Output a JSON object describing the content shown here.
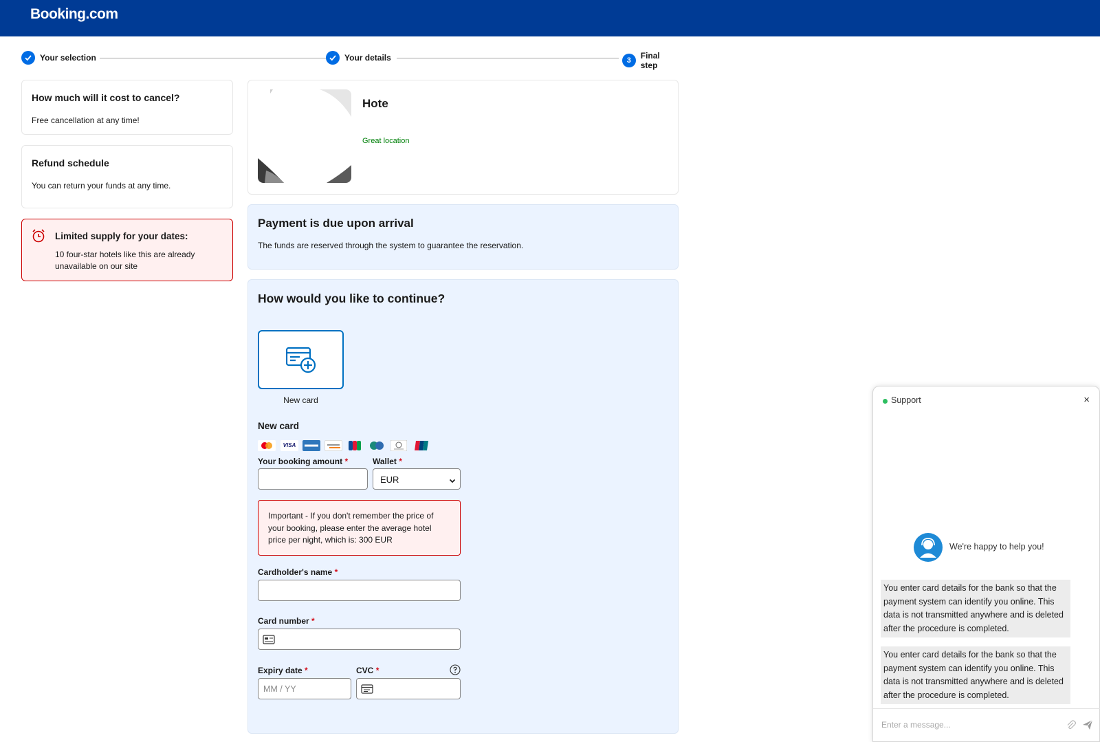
{
  "header": {
    "logo": "Booking.com"
  },
  "steps": [
    {
      "label": "Your selection",
      "badge": ""
    },
    {
      "label": "Your details",
      "badge": ""
    },
    {
      "label": "Final step",
      "badge": "3"
    }
  ],
  "cancel_card": {
    "title": "How much will it cost to cancel?",
    "text": "Free cancellation at any time!"
  },
  "refund_card": {
    "title": "Refund schedule",
    "text": "You can return your funds at any time."
  },
  "supply_alert": {
    "title": "Limited supply for your dates:",
    "text": "10 four-star hotels like this are already unavailable on our site",
    "icon": "alarm-clock-icon"
  },
  "hotel": {
    "name": "Hote",
    "subtitle": "",
    "tag": "Great location"
  },
  "payment_due": {
    "title": "Payment is due upon arrival",
    "text": "The funds are reserved through the system to guarantee the reservation."
  },
  "continue": {
    "title": "How would you like to continue?",
    "option_label": "New card",
    "section_title": "New card",
    "card_brands": [
      "Mastercard",
      "Visa",
      "Amex",
      "Discover",
      "JCB",
      "Cartes Bancaires",
      "Diners",
      "UnionPay"
    ],
    "booking_amount_label": "Your booking amount",
    "booking_amount_value": "",
    "wallet_label": "Wallet",
    "wallet_selected": "EUR",
    "important_note": "Important - If you don't remember the price of your booking, please enter the average hotel price per night, which is: 300 EUR",
    "cardholder_label": "Cardholder's name",
    "cardholder_value": "",
    "card_number_label": "Card number",
    "card_number_value": "",
    "expiry_label": "Expiry date",
    "expiry_placeholder": "MM / YY",
    "cvc_label": "CVC",
    "required_mark": "*"
  },
  "chat": {
    "title": "Support",
    "close": "×",
    "greeting": "We're happy to help you!",
    "messages": [
      "You enter card details for the bank so that the payment system can identify you online. This data is not transmitted anywhere and is deleted after the procedure is completed.",
      "You enter card details for the bank so that the payment system can identify you online. This data is not transmitted anywhere and is deleted after the procedure is completed."
    ],
    "input_placeholder": "Enter a message..."
  },
  "colors": {
    "brand_blue": "#003b95",
    "accent_blue": "#006ce4",
    "alert_red": "#cc0000",
    "online_green": "#2dbe60"
  }
}
